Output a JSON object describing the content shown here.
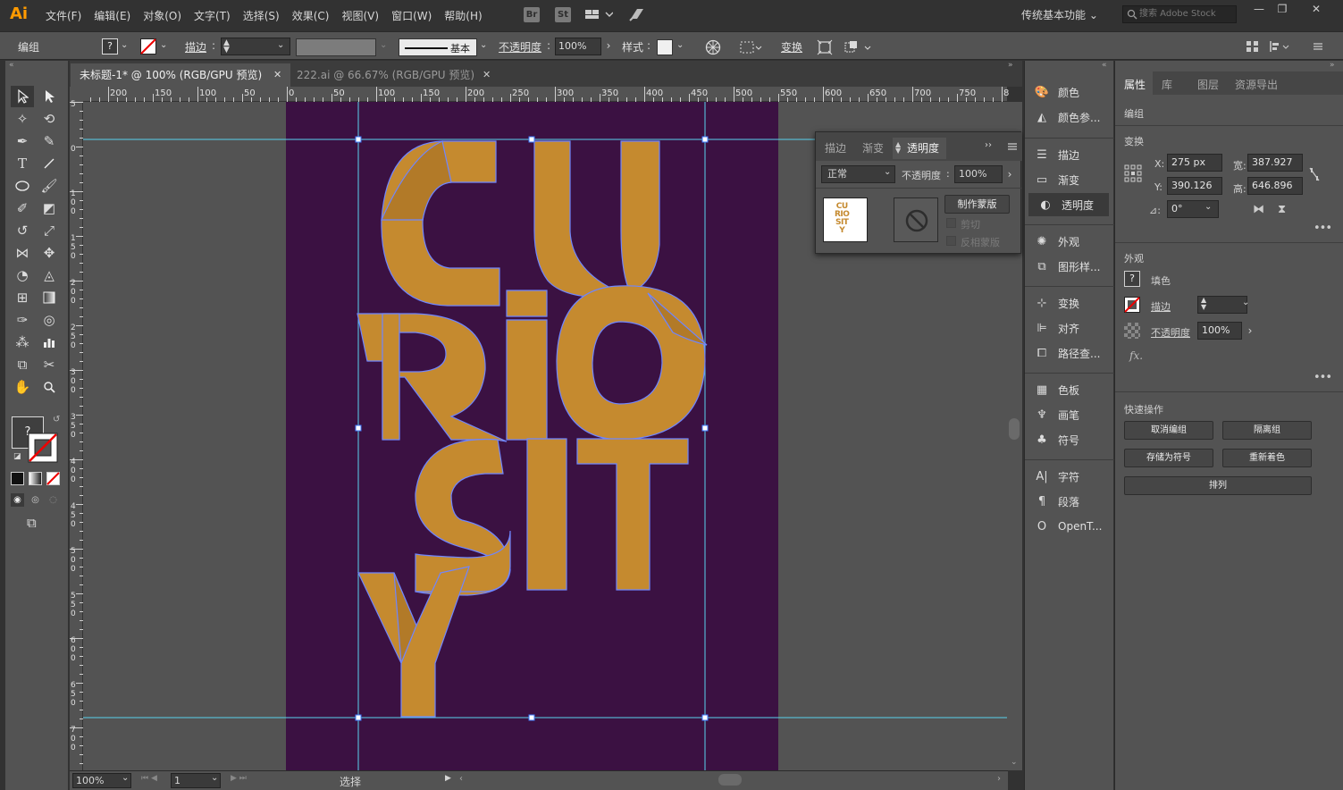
{
  "app": {
    "logo": "Ai"
  },
  "menu": [
    "文件(F)",
    "编辑(E)",
    "对象(O)",
    "文字(T)",
    "选择(S)",
    "效果(C)",
    "视图(V)",
    "窗口(W)",
    "帮助(H)"
  ],
  "appbuttons": {
    "bridge": "Br",
    "stock": "St"
  },
  "workspace": "传统基本功能",
  "search_placeholder": "搜索 Adobe Stock",
  "control": {
    "selection_type": "编组",
    "fill_state": "?",
    "stroke_label": "描边",
    "brush_label": "基本",
    "opacity_label": "不透明度",
    "opacity_value": "100%",
    "style_label": "样式",
    "transform_label": "变换"
  },
  "tabs": [
    {
      "label": "未标题-1* @ 100% (RGB/GPU 预览)",
      "active": true
    },
    {
      "label": "222.ai @ 66.67% (RGB/GPU 预览)",
      "active": false
    }
  ],
  "ruler_h": [
    "200",
    "150",
    "100",
    "50",
    "0",
    "50",
    "100",
    "150",
    "200",
    "250",
    "300",
    "350",
    "400",
    "450",
    "500",
    "550",
    "600",
    "650",
    "700",
    "750",
    "8"
  ],
  "ruler_v": [
    "5",
    "0",
    "1 0 0",
    "1 5 0",
    "2 0 0",
    "2 5 0",
    "3 0 0",
    "3 5 0",
    "4 0 0",
    "4 5 0",
    "5 0 0",
    "5 5 0",
    "6 0 0",
    "6 5 0",
    "7 0 0",
    "7 5 0"
  ],
  "artwork": {
    "lines": [
      "CU",
      "RiO",
      "SIT",
      "Y"
    ],
    "fill_color": "#c58a2f",
    "outline_color": "#6f86ff",
    "artboard_color": "#3b1142"
  },
  "status": {
    "zoom": "100%",
    "page": "1",
    "mode": "选择"
  },
  "transparency_panel": {
    "tabs": [
      "描边",
      "渐变",
      "透明度"
    ],
    "blend_mode": "正常",
    "opacity_label": "不透明度",
    "opacity_value": "100%",
    "make_mask": "制作蒙版",
    "clip": "剪切",
    "invert_mask": "反相蒙版",
    "thumb_text": [
      "CU",
      "RIO",
      "SIT",
      "Y"
    ]
  },
  "dock": [
    {
      "icon": "color-icon",
      "label": "颜色"
    },
    {
      "icon": "color-guide-icon",
      "label": "颜色参..."
    },
    {
      "icon": "stroke-icon",
      "label": "描边"
    },
    {
      "icon": "gradient-icon",
      "label": "渐变"
    },
    {
      "icon": "transparency-icon",
      "label": "透明度"
    },
    {
      "icon": "appearance-icon",
      "label": "外观"
    },
    {
      "icon": "graphic-styles-icon",
      "label": "图形样..."
    },
    {
      "icon": "transform-icon",
      "label": "变换"
    },
    {
      "icon": "align-icon",
      "label": "对齐"
    },
    {
      "icon": "pathfinder-icon",
      "label": "路径查..."
    },
    {
      "icon": "swatches-icon",
      "label": "色板"
    },
    {
      "icon": "brushes-icon",
      "label": "画笔"
    },
    {
      "icon": "symbols-icon",
      "label": "符号"
    },
    {
      "icon": "character-icon",
      "label": "字符"
    },
    {
      "icon": "paragraph-icon",
      "label": "段落"
    },
    {
      "icon": "opentype-icon",
      "label": "OpenT..."
    }
  ],
  "properties": {
    "tabs": [
      "属性",
      "库",
      "图层",
      "资源导出"
    ],
    "selection": "编组",
    "transform_title": "变换",
    "x_label": "X:",
    "x_value": "275 px",
    "y_label": "Y:",
    "y_value": "390.126",
    "w_label": "宽:",
    "w_value": "387.927",
    "h_label": "高:",
    "h_value": "646.896",
    "angle_label": "⊿:",
    "angle_value": "0°",
    "appearance_title": "外观",
    "fill_label": "填色",
    "fill_state": "?",
    "stroke_label": "描边",
    "opacity_label": "不透明度",
    "opacity_value": "100%",
    "fx_label": "fx.",
    "quick_title": "快速操作",
    "quick_buttons": [
      "取消编组",
      "隔离组",
      "存储为符号",
      "重新着色",
      "排列"
    ]
  }
}
